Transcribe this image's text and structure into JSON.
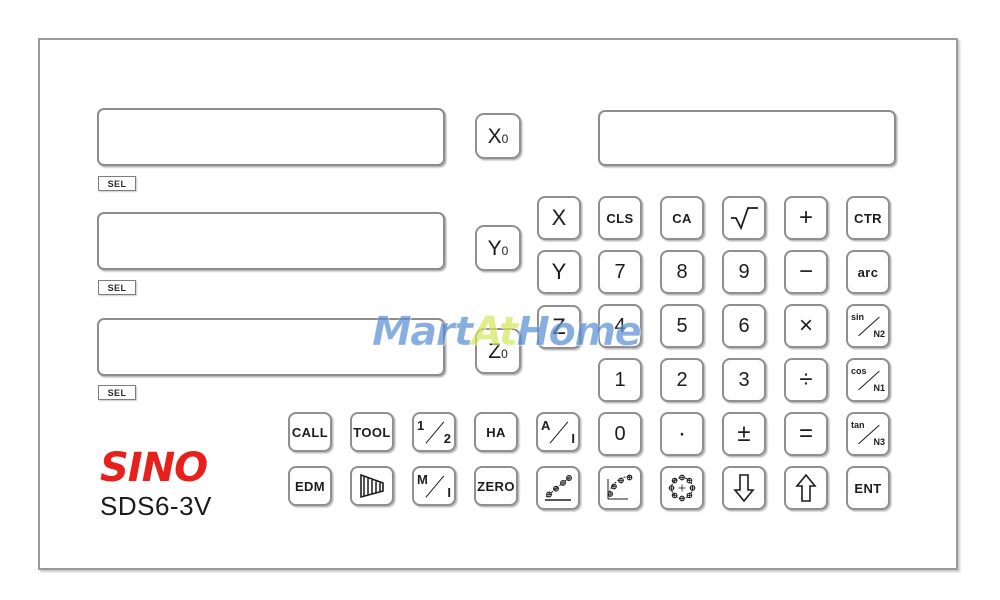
{
  "device": {
    "brand": "SINO",
    "model": "SDS6-3V",
    "brand_color": "#e8201c",
    "model_color": "#1b1b1b"
  },
  "watermark": {
    "part1": "Mart",
    "part2": "At",
    "part3": "Home",
    "color1": "#5b8fd4",
    "color2": "#d4e85c",
    "color3": "#5b8fd4"
  },
  "displays": [
    {
      "name": "x-axis-display",
      "value": ""
    },
    {
      "name": "y-axis-display",
      "value": ""
    },
    {
      "name": "z-axis-display",
      "value": ""
    },
    {
      "name": "aux-display",
      "value": ""
    }
  ],
  "sel_buttons": [
    {
      "label": "SEL"
    },
    {
      "label": "SEL"
    },
    {
      "label": "SEL"
    }
  ],
  "axis_zero_keys": [
    {
      "label": "X",
      "sub": "0",
      "name": "x-zero-key"
    },
    {
      "label": "Y",
      "sub": "0",
      "name": "y-zero-key"
    },
    {
      "label": "Z",
      "sub": "0",
      "name": "z-zero-key"
    }
  ],
  "axis_select_keys": [
    {
      "label": "X",
      "name": "x-axis-key"
    },
    {
      "label": "Y",
      "name": "y-axis-key"
    },
    {
      "label": "Z",
      "name": "z-axis-key"
    }
  ],
  "keypad": {
    "row1": [
      {
        "label": "CLS",
        "name": "clear-key",
        "style": "small"
      },
      {
        "label": "CA",
        "name": "clear-all-key",
        "style": "small"
      },
      {
        "label": "",
        "name": "square-root-key",
        "style": "icon",
        "icon": "sqrt-icon"
      },
      {
        "label": "+",
        "name": "plus-key",
        "style": "op"
      },
      {
        "label": "CTR",
        "name": "center-key",
        "style": "small"
      }
    ],
    "row2": [
      {
        "label": "7",
        "name": "digit-7-key",
        "style": "digit"
      },
      {
        "label": "8",
        "name": "digit-8-key",
        "style": "digit"
      },
      {
        "label": "9",
        "name": "digit-9-key",
        "style": "digit"
      },
      {
        "label": "−",
        "name": "minus-key",
        "style": "op"
      },
      {
        "label": "arc",
        "name": "arc-key",
        "style": "small"
      }
    ],
    "row3": [
      {
        "label": "4",
        "name": "digit-4-key",
        "style": "digit"
      },
      {
        "label": "5",
        "name": "digit-5-key",
        "style": "digit"
      },
      {
        "label": "6",
        "name": "digit-6-key",
        "style": "digit"
      },
      {
        "label": "×",
        "name": "multiply-key",
        "style": "op"
      },
      {
        "top": "sin",
        "bot": "N2",
        "name": "sin-n2-key",
        "style": "frac"
      }
    ],
    "row4": [
      {
        "label": "1",
        "name": "digit-1-key",
        "style": "digit"
      },
      {
        "label": "2",
        "name": "digit-2-key",
        "style": "digit"
      },
      {
        "label": "3",
        "name": "digit-3-key",
        "style": "digit"
      },
      {
        "label": "÷",
        "name": "divide-key",
        "style": "op"
      },
      {
        "top": "cos",
        "bot": "N1",
        "name": "cos-n1-key",
        "style": "frac"
      }
    ],
    "row5": [
      {
        "label": "0",
        "name": "digit-0-key",
        "style": "digit"
      },
      {
        "label": "·",
        "name": "decimal-point-key",
        "style": "op"
      },
      {
        "label": "±",
        "name": "plus-minus-key",
        "style": "op"
      },
      {
        "label": "=",
        "name": "equals-key",
        "style": "op"
      },
      {
        "top": "tan",
        "bot": "N3",
        "name": "tan-n3-key",
        "style": "frac"
      }
    ],
    "row6": [
      {
        "label": "",
        "name": "linear-hole-pattern-key",
        "style": "icon",
        "icon": "linear-hole-pattern-icon"
      },
      {
        "label": "",
        "name": "arc-hole-pattern-key",
        "style": "icon",
        "icon": "arc-hole-pattern-icon"
      },
      {
        "label": "",
        "name": "bolt-circle-pattern-key",
        "style": "icon",
        "icon": "bolt-circle-icon"
      },
      {
        "label": "",
        "name": "arrow-down-key",
        "style": "icon",
        "icon": "arrow-down-icon"
      },
      {
        "label": "",
        "name": "arrow-up-key",
        "style": "icon",
        "icon": "arrow-up-icon"
      },
      {
        "label": "ENT",
        "name": "enter-key",
        "style": "small"
      }
    ]
  },
  "function_keys": {
    "row1": [
      {
        "label": "CALL",
        "name": "call-key",
        "style": "text"
      },
      {
        "label": "TOOL",
        "name": "tool-key",
        "style": "text"
      },
      {
        "top": "1",
        "bot": "2",
        "name": "half-key",
        "style": "frac"
      },
      {
        "label": "HA",
        "name": "ha-key",
        "style": "text"
      },
      {
        "top": "A",
        "bot": "I",
        "name": "abs-inc-key",
        "style": "frac"
      }
    ],
    "row2": [
      {
        "label": "EDM",
        "name": "edm-key",
        "style": "text"
      },
      {
        "label": "",
        "name": "taper-key",
        "style": "icon",
        "icon": "taper-cone-icon"
      },
      {
        "top": "M",
        "bot": "I",
        "name": "mm-inch-key",
        "style": "frac"
      },
      {
        "label": "ZERO",
        "name": "zero-key",
        "style": "text"
      }
    ]
  }
}
